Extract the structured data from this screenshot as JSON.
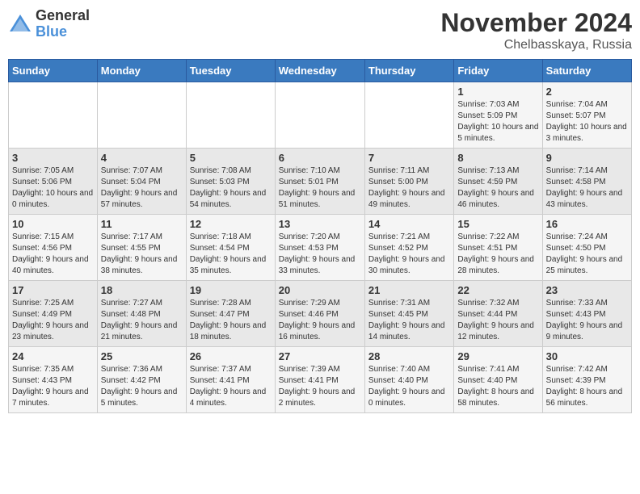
{
  "logo": {
    "general": "General",
    "blue": "Blue"
  },
  "header": {
    "month": "November 2024",
    "location": "Chelbasskaya, Russia"
  },
  "days_of_week": [
    "Sunday",
    "Monday",
    "Tuesday",
    "Wednesday",
    "Thursday",
    "Friday",
    "Saturday"
  ],
  "weeks": [
    [
      {
        "day": "",
        "info": ""
      },
      {
        "day": "",
        "info": ""
      },
      {
        "day": "",
        "info": ""
      },
      {
        "day": "",
        "info": ""
      },
      {
        "day": "",
        "info": ""
      },
      {
        "day": "1",
        "info": "Sunrise: 7:03 AM\nSunset: 5:09 PM\nDaylight: 10 hours and 5 minutes."
      },
      {
        "day": "2",
        "info": "Sunrise: 7:04 AM\nSunset: 5:07 PM\nDaylight: 10 hours and 3 minutes."
      }
    ],
    [
      {
        "day": "3",
        "info": "Sunrise: 7:05 AM\nSunset: 5:06 PM\nDaylight: 10 hours and 0 minutes."
      },
      {
        "day": "4",
        "info": "Sunrise: 7:07 AM\nSunset: 5:04 PM\nDaylight: 9 hours and 57 minutes."
      },
      {
        "day": "5",
        "info": "Sunrise: 7:08 AM\nSunset: 5:03 PM\nDaylight: 9 hours and 54 minutes."
      },
      {
        "day": "6",
        "info": "Sunrise: 7:10 AM\nSunset: 5:01 PM\nDaylight: 9 hours and 51 minutes."
      },
      {
        "day": "7",
        "info": "Sunrise: 7:11 AM\nSunset: 5:00 PM\nDaylight: 9 hours and 49 minutes."
      },
      {
        "day": "8",
        "info": "Sunrise: 7:13 AM\nSunset: 4:59 PM\nDaylight: 9 hours and 46 minutes."
      },
      {
        "day": "9",
        "info": "Sunrise: 7:14 AM\nSunset: 4:58 PM\nDaylight: 9 hours and 43 minutes."
      }
    ],
    [
      {
        "day": "10",
        "info": "Sunrise: 7:15 AM\nSunset: 4:56 PM\nDaylight: 9 hours and 40 minutes."
      },
      {
        "day": "11",
        "info": "Sunrise: 7:17 AM\nSunset: 4:55 PM\nDaylight: 9 hours and 38 minutes."
      },
      {
        "day": "12",
        "info": "Sunrise: 7:18 AM\nSunset: 4:54 PM\nDaylight: 9 hours and 35 minutes."
      },
      {
        "day": "13",
        "info": "Sunrise: 7:20 AM\nSunset: 4:53 PM\nDaylight: 9 hours and 33 minutes."
      },
      {
        "day": "14",
        "info": "Sunrise: 7:21 AM\nSunset: 4:52 PM\nDaylight: 9 hours and 30 minutes."
      },
      {
        "day": "15",
        "info": "Sunrise: 7:22 AM\nSunset: 4:51 PM\nDaylight: 9 hours and 28 minutes."
      },
      {
        "day": "16",
        "info": "Sunrise: 7:24 AM\nSunset: 4:50 PM\nDaylight: 9 hours and 25 minutes."
      }
    ],
    [
      {
        "day": "17",
        "info": "Sunrise: 7:25 AM\nSunset: 4:49 PM\nDaylight: 9 hours and 23 minutes."
      },
      {
        "day": "18",
        "info": "Sunrise: 7:27 AM\nSunset: 4:48 PM\nDaylight: 9 hours and 21 minutes."
      },
      {
        "day": "19",
        "info": "Sunrise: 7:28 AM\nSunset: 4:47 PM\nDaylight: 9 hours and 18 minutes."
      },
      {
        "day": "20",
        "info": "Sunrise: 7:29 AM\nSunset: 4:46 PM\nDaylight: 9 hours and 16 minutes."
      },
      {
        "day": "21",
        "info": "Sunrise: 7:31 AM\nSunset: 4:45 PM\nDaylight: 9 hours and 14 minutes."
      },
      {
        "day": "22",
        "info": "Sunrise: 7:32 AM\nSunset: 4:44 PM\nDaylight: 9 hours and 12 minutes."
      },
      {
        "day": "23",
        "info": "Sunrise: 7:33 AM\nSunset: 4:43 PM\nDaylight: 9 hours and 9 minutes."
      }
    ],
    [
      {
        "day": "24",
        "info": "Sunrise: 7:35 AM\nSunset: 4:43 PM\nDaylight: 9 hours and 7 minutes."
      },
      {
        "day": "25",
        "info": "Sunrise: 7:36 AM\nSunset: 4:42 PM\nDaylight: 9 hours and 5 minutes."
      },
      {
        "day": "26",
        "info": "Sunrise: 7:37 AM\nSunset: 4:41 PM\nDaylight: 9 hours and 4 minutes."
      },
      {
        "day": "27",
        "info": "Sunrise: 7:39 AM\nSunset: 4:41 PM\nDaylight: 9 hours and 2 minutes."
      },
      {
        "day": "28",
        "info": "Sunrise: 7:40 AM\nSunset: 4:40 PM\nDaylight: 9 hours and 0 minutes."
      },
      {
        "day": "29",
        "info": "Sunrise: 7:41 AM\nSunset: 4:40 PM\nDaylight: 8 hours and 58 minutes."
      },
      {
        "day": "30",
        "info": "Sunrise: 7:42 AM\nSunset: 4:39 PM\nDaylight: 8 hours and 56 minutes."
      }
    ]
  ]
}
